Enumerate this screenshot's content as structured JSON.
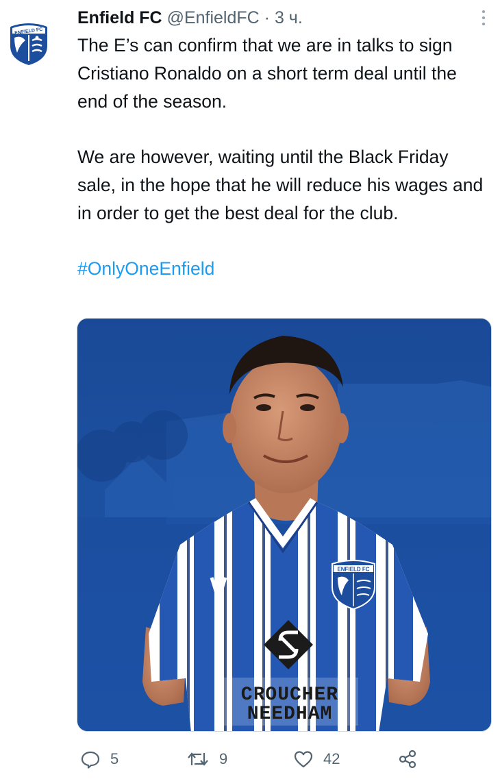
{
  "tweet": {
    "author_name": "Enfield FC",
    "handle": "@EnfieldFC",
    "separator": "·",
    "time": "3 ч.",
    "paragraph1": "The E’s can confirm that we are in talks to sign Cristiano Ronaldo on a short term deal until the end of the season.",
    "paragraph2": "We are however, waiting until the Black Friday sale, in the hope that he will reduce his wages and in order to get the best deal for the club.",
    "hashtag": "#OnlyOneEnfield",
    "avatar_badge_text": "ENFIELD FC",
    "media": {
      "crest_text": "ENFIELD FC",
      "sponsor_line1": "CROUCHER",
      "sponsor_line2": "NEEDHAM"
    },
    "actions": {
      "replies": "5",
      "retweets": "9",
      "likes": "42"
    }
  },
  "colors": {
    "link": "#1d9bf0",
    "secondary_text": "#536471",
    "club_blue": "#1c4f9f"
  },
  "icons": {
    "reply": "speech-bubble-icon",
    "retweet": "retweet-icon",
    "like": "heart-icon",
    "share": "share-icon",
    "more": "more-dots-icon"
  }
}
